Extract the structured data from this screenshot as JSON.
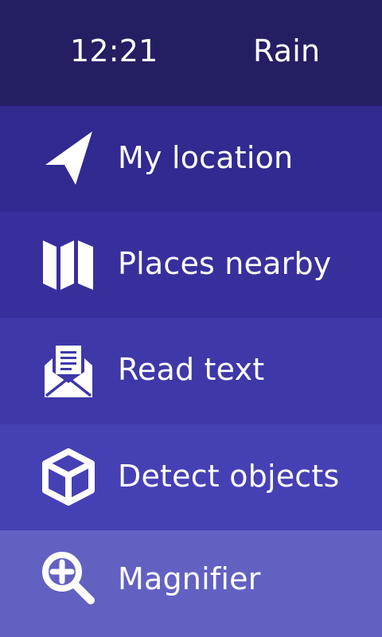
{
  "status": {
    "time": "12:21",
    "weather": "Rain"
  },
  "menu": {
    "items": [
      {
        "label": "My location",
        "icon": "location-arrow-icon"
      },
      {
        "label": "Places nearby",
        "icon": "map-icon"
      },
      {
        "label": "Read text",
        "icon": "envelope-open-icon"
      },
      {
        "label": "Detect objects",
        "icon": "cube-icon"
      },
      {
        "label": "Magnifier",
        "icon": "magnifier-plus-icon"
      }
    ]
  },
  "colors": {
    "status_bar": "#241f63",
    "item_backgrounds": [
      "#302a91",
      "#37309c",
      "#3e38a8",
      "#4640b5",
      "#6261c2"
    ],
    "foreground": "#ffffff"
  }
}
